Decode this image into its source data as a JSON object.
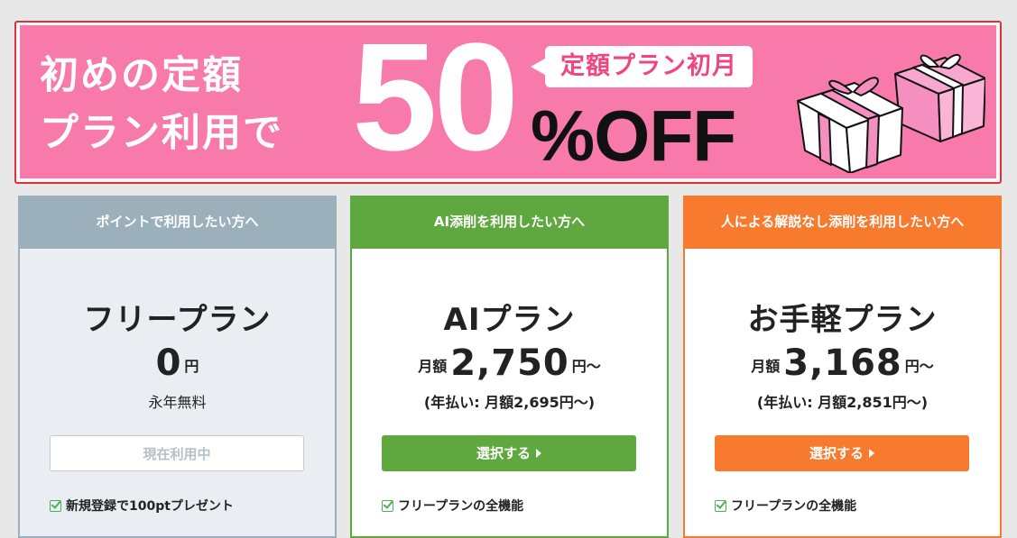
{
  "banner": {
    "headline_line1": "初めの定額",
    "headline_line2": "プラン利用で",
    "big_number": "50",
    "bubble_text": "定額プラン初月",
    "off_text": "%OFF"
  },
  "colors": {
    "banner_pink": "#f77aaa",
    "free_header": "#9bb0bb",
    "ai_header": "#5ea83f",
    "easy_header": "#f77a2e"
  },
  "plans": [
    {
      "header": "ポイントで利用したい方へ",
      "name": "フリープラン",
      "price_prefix": "",
      "price": "0",
      "price_unit": "円",
      "sub": "永年無料",
      "button": "現在利用中",
      "feature": "新規登録で100ptプレゼント"
    },
    {
      "header": "AI添削を利用したい方へ",
      "name": "AIプラン",
      "price_prefix": "月額",
      "price": "2,750",
      "price_unit": "円〜",
      "sub": "(年払い: 月額2,695円〜)",
      "button": "選択する",
      "feature": "フリープランの全機能"
    },
    {
      "header": "人による解説なし添削を利用したい方へ",
      "name": "お手軽プラン",
      "price_prefix": "月額",
      "price": "3,168",
      "price_unit": "円〜",
      "sub": "(年払い: 月額2,851円〜)",
      "button": "選択する",
      "feature": "フリープランの全機能"
    }
  ]
}
